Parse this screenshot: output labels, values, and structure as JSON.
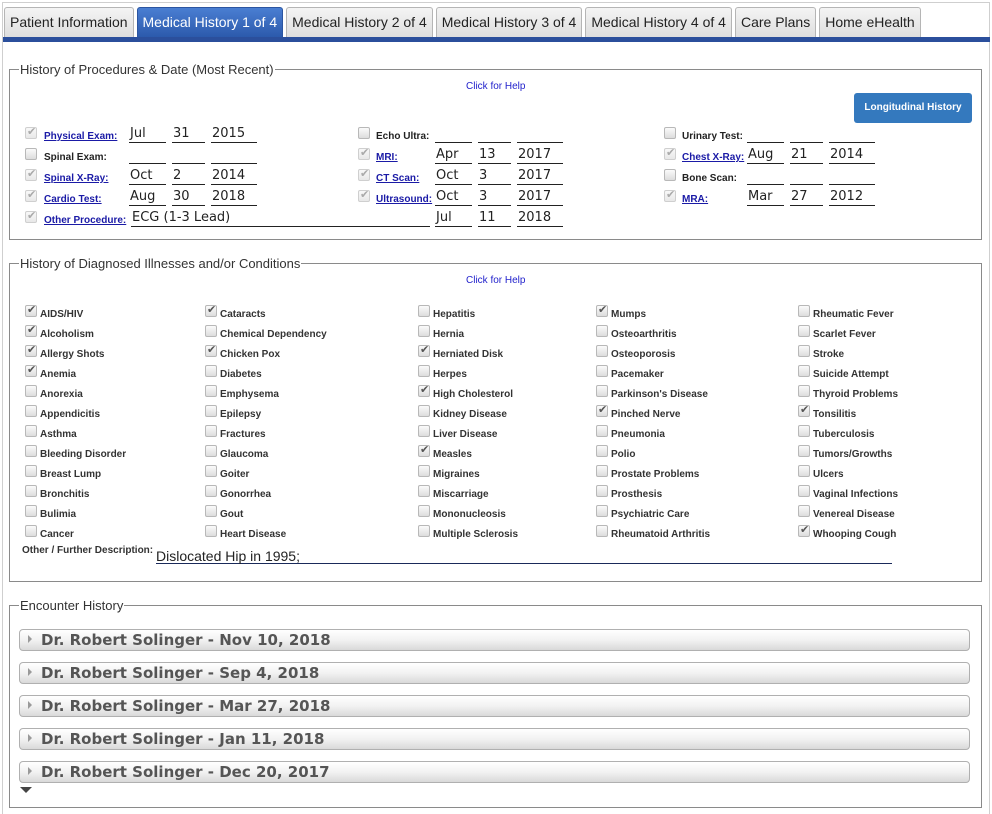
{
  "tabs": [
    {
      "label": "Patient Information",
      "active": false
    },
    {
      "label": "Medical History 1 of 4",
      "active": true
    },
    {
      "label": "Medical History 2 of 4",
      "active": false
    },
    {
      "label": "Medical History 3 of 4",
      "active": false
    },
    {
      "label": "Medical History 4 of 4",
      "active": false
    },
    {
      "label": "Care Plans",
      "active": false
    },
    {
      "label": "Home eHealth",
      "active": false
    }
  ],
  "procedures": {
    "legend": "History of Procedures & Date (Most Recent)",
    "help_link": "Click for Help",
    "longitudinal_button": "Longitudinal History",
    "items": [
      {
        "label": "Physical Exam:",
        "checked": true,
        "link": true,
        "month": "Jul",
        "day": "31",
        "year": "2015"
      },
      {
        "label": "Spinal Exam:",
        "checked": false,
        "link": false,
        "month": "",
        "day": "",
        "year": ""
      },
      {
        "label": "Spinal X-Ray:",
        "checked": true,
        "link": true,
        "month": "Oct",
        "day": "2",
        "year": "2014"
      },
      {
        "label": "Cardio Test:",
        "checked": true,
        "link": true,
        "month": "Aug",
        "day": "30",
        "year": "2018"
      },
      {
        "label": "Echo Ultra:",
        "checked": false,
        "link": false,
        "month": "",
        "day": "",
        "year": ""
      },
      {
        "label": "MRI:",
        "checked": true,
        "link": true,
        "month": "Apr",
        "day": "13",
        "year": "2017"
      },
      {
        "label": "CT Scan:",
        "checked": true,
        "link": true,
        "month": "Oct",
        "day": "3",
        "year": "2017"
      },
      {
        "label": "Ultrasound:",
        "checked": true,
        "link": true,
        "month": "Oct",
        "day": "3",
        "year": "2017"
      },
      {
        "label": "Urinary Test:",
        "checked": false,
        "link": false,
        "month": "",
        "day": "",
        "year": ""
      },
      {
        "label": "Chest X-Ray:",
        "checked": true,
        "link": true,
        "month": "Aug",
        "day": "21",
        "year": "2014"
      },
      {
        "label": "Bone Scan:",
        "checked": false,
        "link": false,
        "month": "",
        "day": "",
        "year": ""
      },
      {
        "label": "MRA:",
        "checked": true,
        "link": true,
        "month": "Mar",
        "day": "27",
        "year": "2012"
      }
    ],
    "other": {
      "label": "Other Procedure:",
      "checked": true,
      "value": "ECG (1-3 Lead)",
      "month": "Jul",
      "day": "11",
      "year": "2018"
    }
  },
  "illnesses": {
    "legend": "History of Diagnosed Illnesses and/or Conditions",
    "help_link": "Click for Help",
    "columns": [
      [
        {
          "label": "AIDS/HIV",
          "checked": true
        },
        {
          "label": "Alcoholism",
          "checked": true
        },
        {
          "label": "Allergy Shots",
          "checked": true
        },
        {
          "label": "Anemia",
          "checked": true
        },
        {
          "label": "Anorexia",
          "checked": false
        },
        {
          "label": "Appendicitis",
          "checked": false
        },
        {
          "label": "Asthma",
          "checked": false
        },
        {
          "label": "Bleeding Disorder",
          "checked": false
        },
        {
          "label": "Breast Lump",
          "checked": false
        },
        {
          "label": "Bronchitis",
          "checked": false
        },
        {
          "label": "Bulimia",
          "checked": false
        },
        {
          "label": "Cancer",
          "checked": false
        }
      ],
      [
        {
          "label": "Cataracts",
          "checked": true
        },
        {
          "label": "Chemical Dependency",
          "checked": false
        },
        {
          "label": "Chicken Pox",
          "checked": true
        },
        {
          "label": "Diabetes",
          "checked": false
        },
        {
          "label": "Emphysema",
          "checked": false
        },
        {
          "label": "Epilepsy",
          "checked": false
        },
        {
          "label": "Fractures",
          "checked": false
        },
        {
          "label": "Glaucoma",
          "checked": false
        },
        {
          "label": "Goiter",
          "checked": false
        },
        {
          "label": "Gonorrhea",
          "checked": false
        },
        {
          "label": "Gout",
          "checked": false
        },
        {
          "label": "Heart Disease",
          "checked": false
        }
      ],
      [
        {
          "label": "Hepatitis",
          "checked": false
        },
        {
          "label": "Hernia",
          "checked": false
        },
        {
          "label": "Herniated Disk",
          "checked": true
        },
        {
          "label": "Herpes",
          "checked": false
        },
        {
          "label": "High Cholesterol",
          "checked": true
        },
        {
          "label": "Kidney Disease",
          "checked": false
        },
        {
          "label": "Liver Disease",
          "checked": false
        },
        {
          "label": "Measles",
          "checked": true
        },
        {
          "label": "Migraines",
          "checked": false
        },
        {
          "label": "Miscarriage",
          "checked": false
        },
        {
          "label": "Mononucleosis",
          "checked": false
        },
        {
          "label": "Multiple Sclerosis",
          "checked": false
        }
      ],
      [
        {
          "label": "Mumps",
          "checked": true
        },
        {
          "label": "Osteoarthritis",
          "checked": false
        },
        {
          "label": "Osteoporosis",
          "checked": false
        },
        {
          "label": "Pacemaker",
          "checked": false
        },
        {
          "label": "Parkinson's Disease",
          "checked": false
        },
        {
          "label": "Pinched Nerve",
          "checked": true
        },
        {
          "label": "Pneumonia",
          "checked": false
        },
        {
          "label": "Polio",
          "checked": false
        },
        {
          "label": "Prostate Problems",
          "checked": false
        },
        {
          "label": "Prosthesis",
          "checked": false
        },
        {
          "label": "Psychiatric Care",
          "checked": false
        },
        {
          "label": "Rheumatoid Arthritis",
          "checked": false
        }
      ],
      [
        {
          "label": "Rheumatic Fever",
          "checked": false
        },
        {
          "label": "Scarlet Fever",
          "checked": false
        },
        {
          "label": "Stroke",
          "checked": false
        },
        {
          "label": "Suicide Attempt",
          "checked": false
        },
        {
          "label": "Thyroid Problems",
          "checked": false
        },
        {
          "label": "Tonsilitis",
          "checked": true
        },
        {
          "label": "Tuberculosis",
          "checked": false
        },
        {
          "label": "Tumors/Growths",
          "checked": false
        },
        {
          "label": "Ulcers",
          "checked": false
        },
        {
          "label": "Vaginal Infections",
          "checked": false
        },
        {
          "label": "Venereal Disease",
          "checked": false
        },
        {
          "label": "Whooping Cough",
          "checked": true
        }
      ]
    ],
    "description_label": "Other / Further Description:",
    "description_value": "Dislocated Hip in 1995;"
  },
  "encounters": {
    "legend": "Encounter History",
    "items": [
      "Dr. Robert Solinger - Nov 10, 2018",
      "Dr. Robert Solinger - Sep 4, 2018",
      "Dr. Robert Solinger - Mar 27, 2018",
      "Dr. Robert Solinger - Jan 11, 2018",
      "Dr. Robert Solinger - Dec 20, 2017"
    ]
  }
}
